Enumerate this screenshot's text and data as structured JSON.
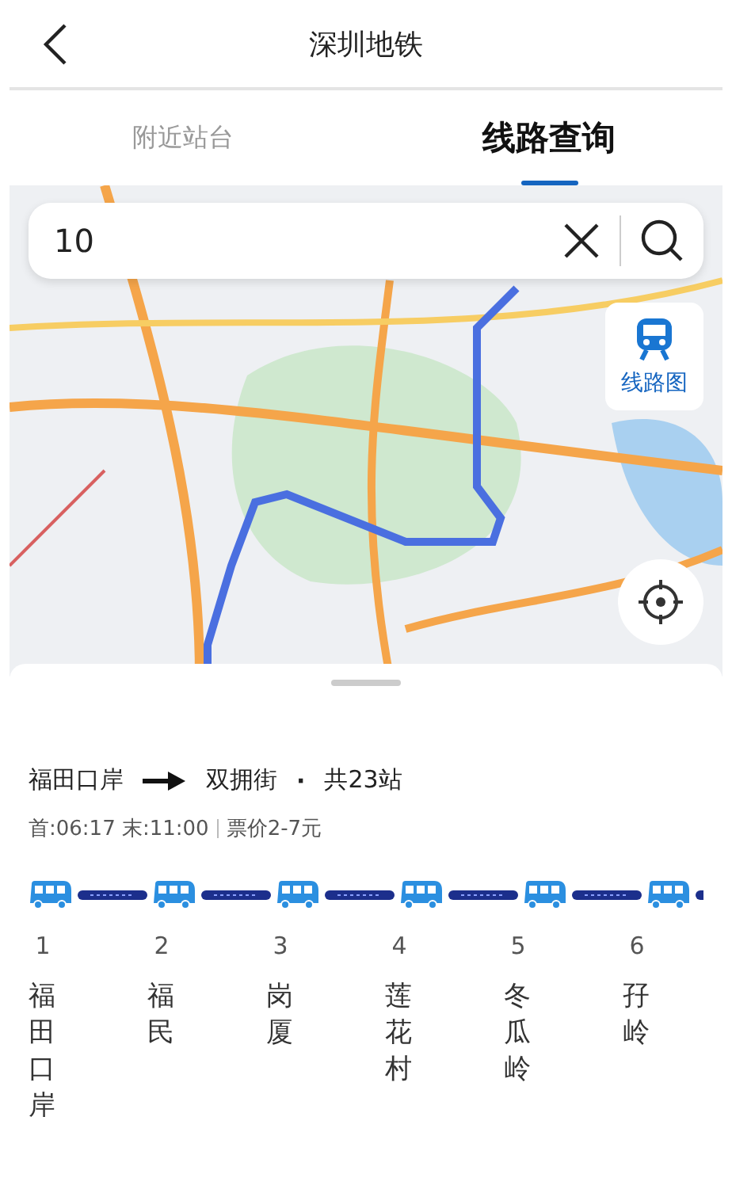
{
  "header": {
    "title": "深圳地铁"
  },
  "tabs": [
    {
      "label": "附近站台",
      "selected": false
    },
    {
      "label": "线路查询",
      "selected": true
    }
  ],
  "search": {
    "value": "10"
  },
  "map": {
    "route_map_button": "线路图"
  },
  "line": {
    "from": "福田口岸",
    "to": "双拥街",
    "separator": "·",
    "total": "共23站",
    "hours": "首:06:17 末:11:00",
    "fare": "票价2-7元"
  },
  "stations": [
    {
      "number": "1",
      "name": "福田口岸"
    },
    {
      "number": "2",
      "name": "福民"
    },
    {
      "number": "3",
      "name": "岗厦"
    },
    {
      "number": "4",
      "name": "莲花村"
    },
    {
      "number": "5",
      "name": "冬瓜岭"
    },
    {
      "number": "6",
      "name": "孖岭"
    }
  ]
}
